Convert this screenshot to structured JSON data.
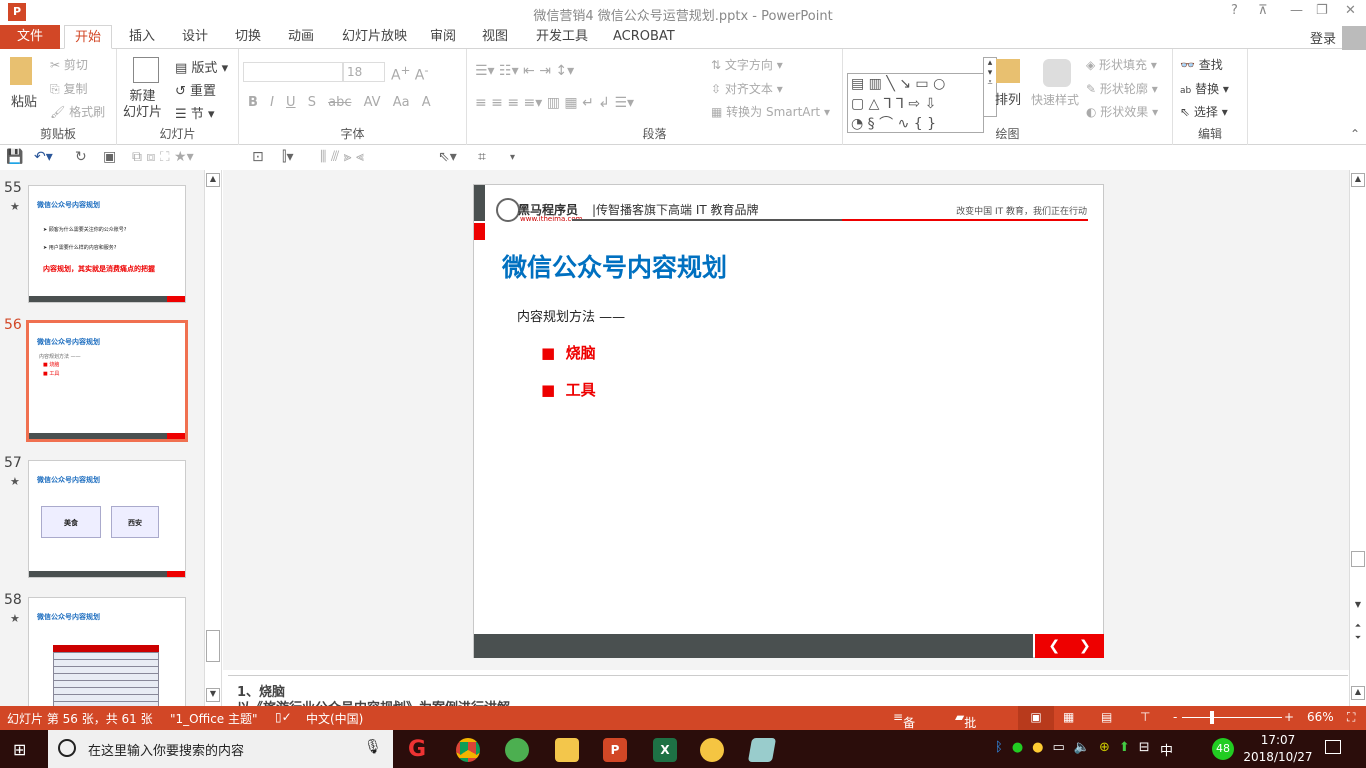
{
  "window": {
    "title": "微信营销4 微信公众号运营规划.pptx - PowerPoint",
    "help": "?",
    "minimize": "—",
    "restore": "❐",
    "close": "✕",
    "login": "登录"
  },
  "tabs": [
    {
      "label": "文件"
    },
    {
      "label": "开始"
    },
    {
      "label": "插入"
    },
    {
      "label": "设计"
    },
    {
      "label": "切换"
    },
    {
      "label": "动画"
    },
    {
      "label": "幻灯片放映"
    },
    {
      "label": "审阅"
    },
    {
      "label": "视图"
    },
    {
      "label": "开发工具"
    },
    {
      "label": "ACROBAT"
    }
  ],
  "ribbon": {
    "clipboard": {
      "label": "剪贴板",
      "paste": "粘贴",
      "cut": "剪切",
      "copy": "复制",
      "format_painter": "格式刷"
    },
    "slides": {
      "label": "幻灯片",
      "new_slide": "新建\n幻灯片",
      "layout": "版式",
      "reset": "重置",
      "section": "节"
    },
    "font": {
      "label": "字体",
      "font_name": "",
      "font_size": "18",
      "bold": "B",
      "italic": "I",
      "underline": "U",
      "shadow": "S",
      "strike": "abc",
      "spacing": "AV",
      "case": "Aa",
      "color": "A"
    },
    "paragraph": {
      "label": "段落",
      "text_direction": "文字方向",
      "align_text": "对齐文本",
      "smartart": "转换为 SmartArt"
    },
    "drawing": {
      "label": "绘图",
      "arrange": "排列",
      "quick_styles": "快速样式",
      "shape_fill": "形状填充",
      "shape_outline": "形状轮廓",
      "shape_effects": "形状效果"
    },
    "editing": {
      "label": "编辑",
      "find": "查找",
      "replace": "替换",
      "select": "选择"
    }
  },
  "thumbnails": [
    {
      "num": "55",
      "title": "微信公众号内容规划",
      "lines": [
        "➤ 顾客为什么需要关注你的公众账号?",
        "➤ 用户需要什么样的内容和服务?"
      ],
      "highlight": "内容规划，其实就是消费痛点的把握"
    },
    {
      "num": "56",
      "title": "微信公众号内容规划",
      "lines": [
        "内容规划方法 ——",
        "■ 烧脑",
        "■ 工具"
      ]
    },
    {
      "num": "57",
      "title": "微信公众号内容规划",
      "lines": [
        "美食",
        "西安"
      ]
    },
    {
      "num": "58",
      "title": "微信公众号内容规划",
      "lines": []
    }
  ],
  "slide": {
    "brand": "黑马程序员",
    "url": "www.itheima.com",
    "slogan": "|传智播客旗下高端 IT 教育品牌",
    "motto": "改变中国 IT 教育，我们正在行动",
    "title": "微信公众号内容规划",
    "subtitle": "内容规划方法 ——",
    "bullets": [
      "烧脑",
      "工具"
    ],
    "prev": "❮",
    "next": "❯",
    "title_color": "#0070c0",
    "bullet_color": "#e00000"
  },
  "notes": {
    "line1": "1、烧脑",
    "line2": "以《旅游行业公众号内容规划》为案例进行讲解"
  },
  "status": {
    "slide_info": "幻灯片 第 56 张，共 61 张",
    "theme": "\"1_Office 主题\"",
    "language": "中文(中国)",
    "notes": "备注",
    "comments": "批注",
    "zoom": "66%",
    "minus": "-",
    "plus": "+",
    "zoom_level_percent": 66
  },
  "taskbar": {
    "search_placeholder": "在这里输入你要搜索的内容",
    "time": "17:07",
    "date": "2018/10/27",
    "ime": "中",
    "badge": "48"
  },
  "colors": {
    "accent": "#d24726",
    "taskbar": "#2b0d0b"
  }
}
